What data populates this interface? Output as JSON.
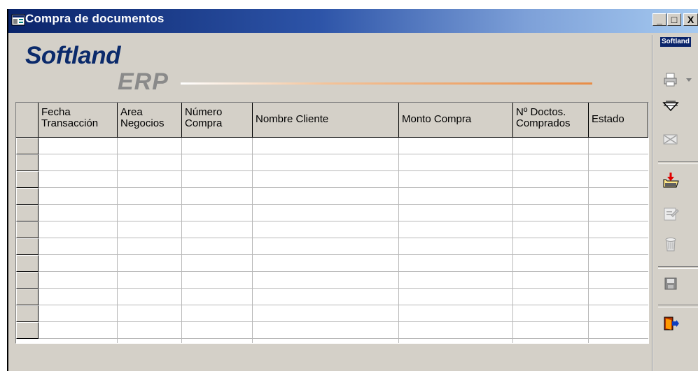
{
  "window": {
    "title": "Compra de documentos",
    "controls": {
      "minimize": "_",
      "maximize": "□",
      "close": "X"
    }
  },
  "logo": {
    "brand": "Softland",
    "product": "ERP"
  },
  "toolbar": {
    "tag": "Softland",
    "buttons": [
      "print-icon",
      "print-dropdown-icon",
      "approve-icon",
      "reject-icon",
      "import-icon",
      "properties-icon",
      "delete-icon",
      "save-icon",
      "exit-icon"
    ]
  },
  "grid": {
    "columns": [
      {
        "line1": "Fecha",
        "line2": "Transacción"
      },
      {
        "line1": "Area",
        "line2": "Negocios"
      },
      {
        "line1": "Número",
        "line2": "Compra"
      },
      {
        "line1": "Nombre  Cliente",
        "line2": ""
      },
      {
        "line1": "Monto Compra",
        "line2": ""
      },
      {
        "line1": "Nº Doctos.",
        "line2": "Comprados"
      },
      {
        "line1": "Estado",
        "line2": ""
      }
    ],
    "row_count": 12,
    "rows": []
  },
  "colors": {
    "title_bar": "#0a246a",
    "brand_blue": "#0b2a6b",
    "erp_gray": "#8a8a8a",
    "accent_orange": "#e88c46",
    "face": "#d4d0c8"
  }
}
